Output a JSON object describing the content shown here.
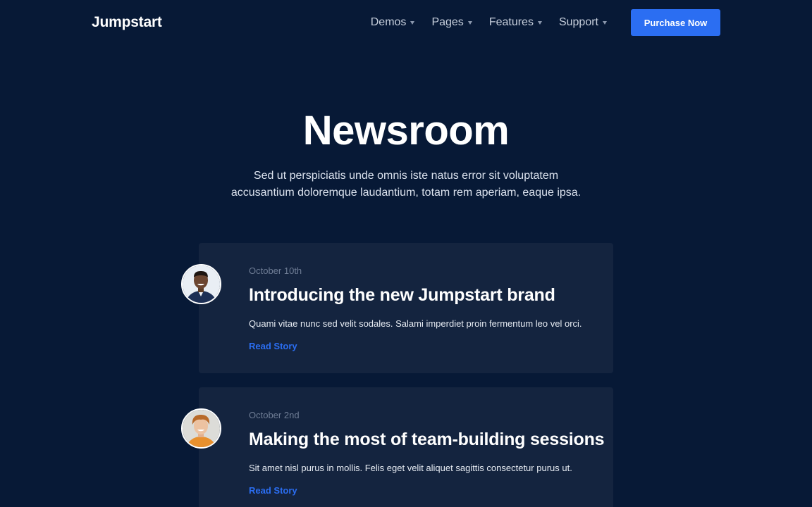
{
  "header": {
    "logo": "Jumpstart",
    "nav": [
      {
        "label": "Demos"
      },
      {
        "label": "Pages"
      },
      {
        "label": "Features"
      },
      {
        "label": "Support"
      }
    ],
    "cta_label": "Purchase Now"
  },
  "hero": {
    "title": "Newsroom",
    "subtitle_line1": "Sed ut perspiciatis unde omnis iste natus error sit voluptatem",
    "subtitle_line2": "accusantium doloremque laudantium, totam rem aperiam, eaque ipsa."
  },
  "posts": [
    {
      "date": "October 10th",
      "title": "Introducing the new Jumpstart brand",
      "excerpt": "Quami vitae nunc sed velit sodales. Salami imperdiet proin fermentum leo vel orci.",
      "link_label": "Read Story"
    },
    {
      "date": "October 2nd",
      "title": "Making the most of team-building sessions",
      "excerpt": "Sit amet nisl purus in mollis. Felis eget velit aliquet sagittis consectetur purus ut.",
      "link_label": "Read Story"
    }
  ],
  "colors": {
    "background": "#071936",
    "card": "#14243f",
    "accent": "#2b6ef2"
  }
}
